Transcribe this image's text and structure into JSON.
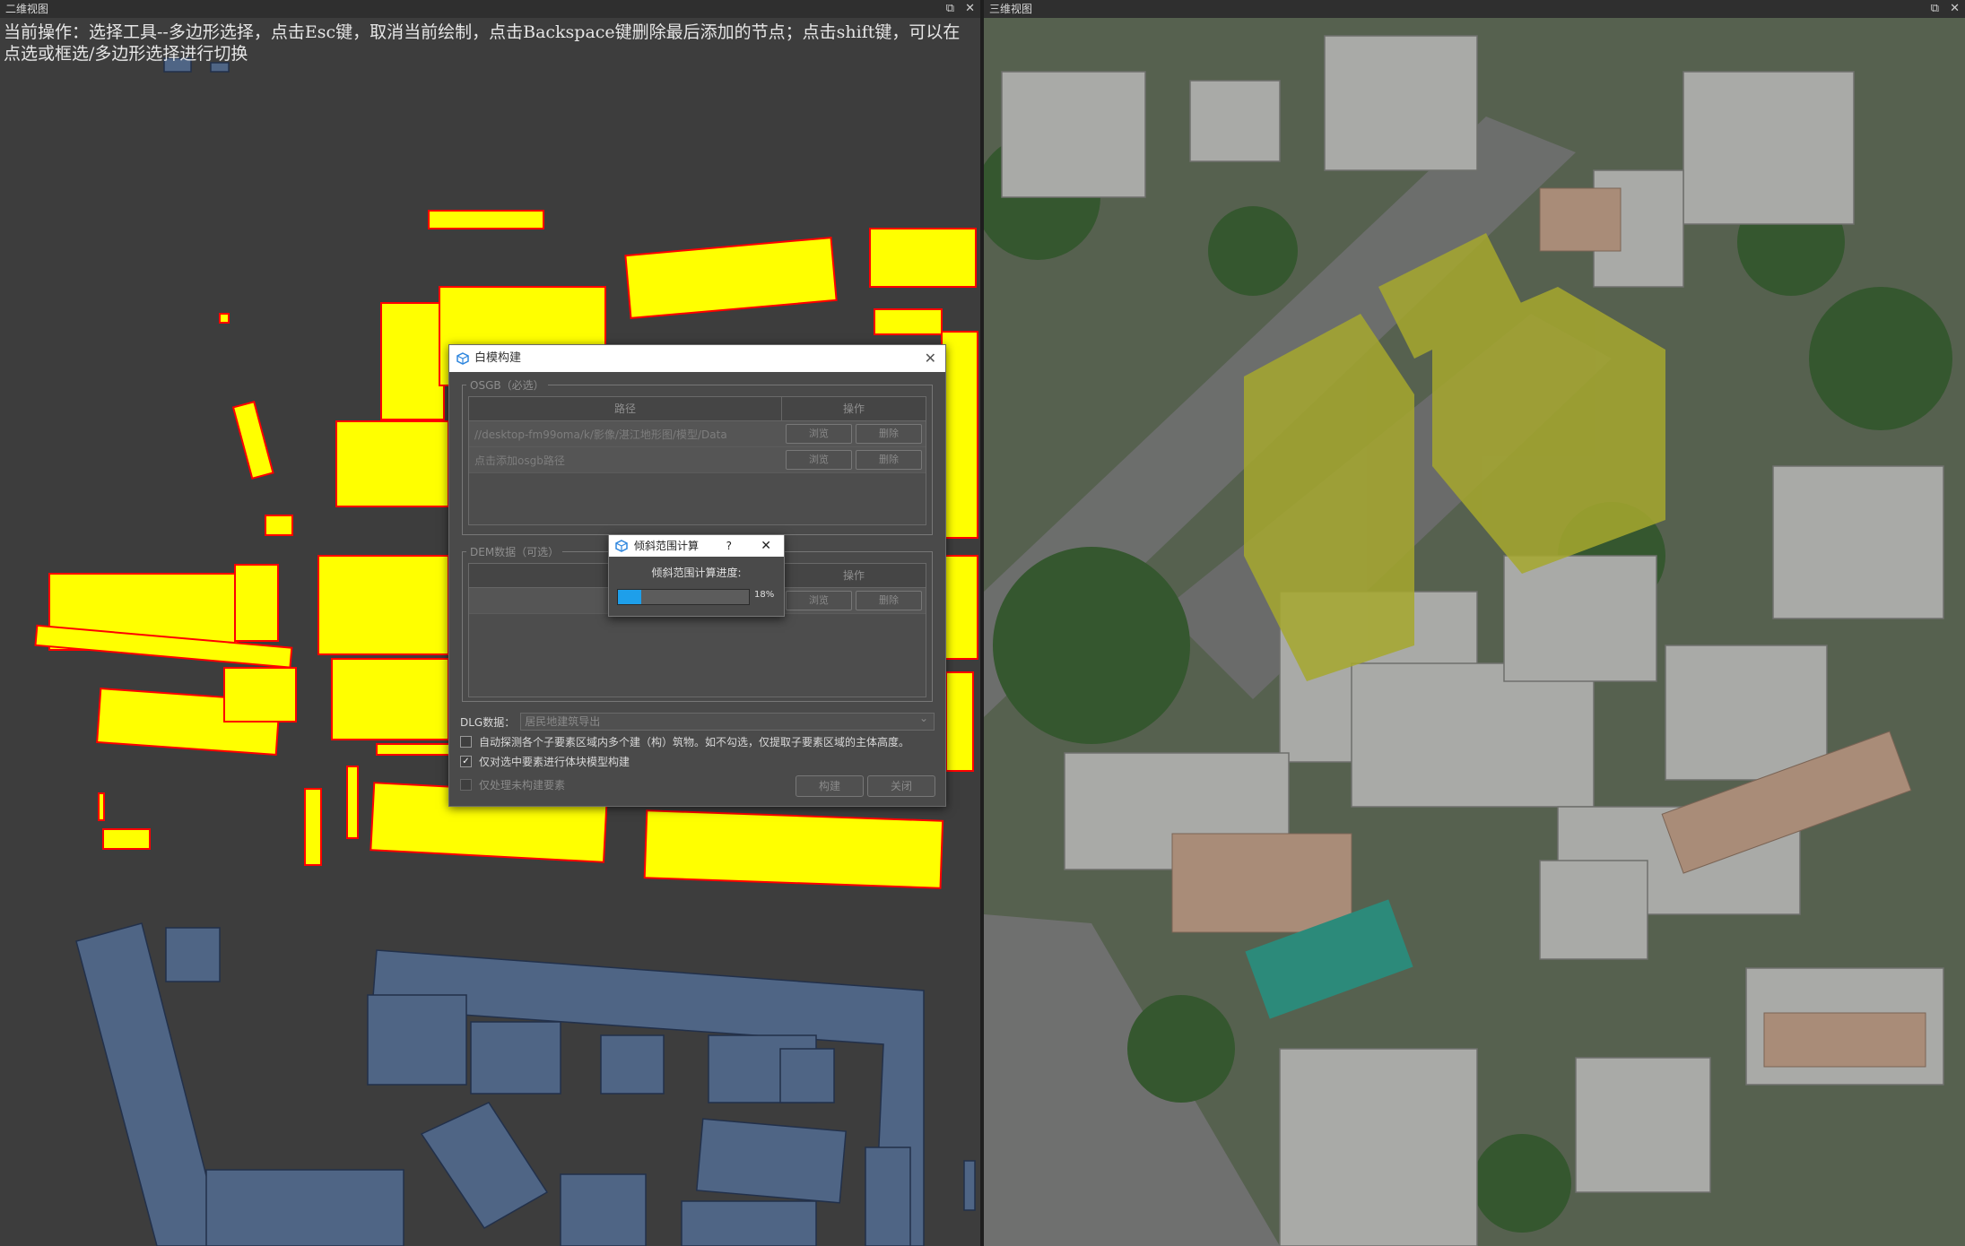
{
  "left_view": {
    "title": "二维视图",
    "buttons": {
      "restore": "⧉",
      "close": "✕"
    },
    "hint_text": "当前操作：选择工具--多边形选择，点击Esc键，取消当前绘制，点击Backspace键删除最后添加的节点；点击shift键，可以在点选或框选/多边形选择进行切换",
    "colors": {
      "background": "#3d3d3d",
      "selected_building": "#ffff00",
      "selected_outline": "#ff0000",
      "unselected_building": "#4f6585"
    }
  },
  "right_view": {
    "title": "三维视图",
    "buttons": {
      "restore": "⧉",
      "close": "✕"
    }
  },
  "dialog": {
    "title": "白模构建",
    "close": "✕",
    "osgb_group_label": "OSGB（必选）",
    "osgb_table": {
      "col_path": "路径",
      "col_op": "操作",
      "rows": [
        {
          "path": "//desktop-fm99oma/k/影像/湛江地形图/模型/Data",
          "browse": "浏览",
          "delete": "删除"
        },
        {
          "path": "点击添加osgb路径",
          "browse": "浏览",
          "delete": "删除"
        }
      ]
    },
    "dem_group_label": "DEM数据（可选）",
    "dem_table": {
      "col_path": "路径",
      "col_op": "操作",
      "rows": [
        {
          "path": "",
          "browse": "浏览",
          "delete": "删除"
        }
      ]
    },
    "dlg_label": "DLG数据：",
    "dlg_value": "居民地建筑导出",
    "option1": "自动探测各个子要素区域内多个建（构）筑物。如不勾选，仅提取子要素区域的主体高度。",
    "option1_checked": false,
    "option2": "仅对选中要素进行体块模型构建",
    "option2_checked": true,
    "option3": "仅处理未构建要素",
    "option3_checked": false,
    "build_button": "构建",
    "close_button": "关闭"
  },
  "progress": {
    "title": "倾斜范围计算",
    "help": "?",
    "close": "✕",
    "label": "倾斜范围计算进度:",
    "percent_text": "18%",
    "value": 0.18
  }
}
